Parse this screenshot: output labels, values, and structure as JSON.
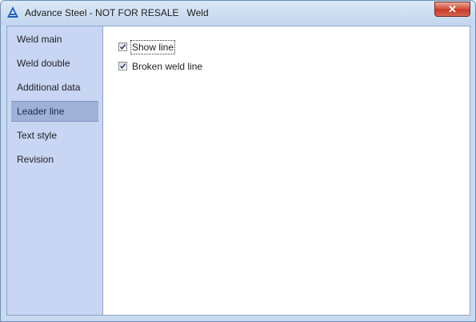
{
  "window": {
    "title": "Advance Steel - NOT FOR RESALE   Weld",
    "close_label": "✕"
  },
  "sidebar": {
    "items": [
      {
        "label": "Weld main",
        "selected": false
      },
      {
        "label": "Weld double",
        "selected": false
      },
      {
        "label": "Additional data",
        "selected": false
      },
      {
        "label": "Leader line",
        "selected": true
      },
      {
        "label": "Text style",
        "selected": false
      },
      {
        "label": "Revision",
        "selected": false
      }
    ]
  },
  "content": {
    "options": [
      {
        "label": "Show line",
        "checked": true
      },
      {
        "label": "Broken weld line",
        "checked": true
      }
    ]
  },
  "colors": {
    "sidebar_bg": "#c8d6f4",
    "selected_bg": "#9fb1d7",
    "title_bg": "#c3d6ee",
    "close_red": "#c43b27"
  }
}
